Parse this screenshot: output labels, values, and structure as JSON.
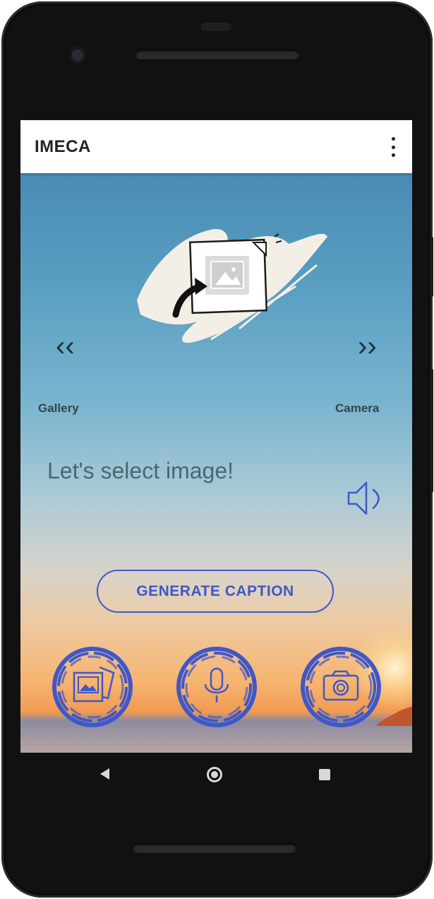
{
  "app": {
    "title": "IMECA"
  },
  "toolbar": {
    "menu_icon": "more-vert-icon"
  },
  "main": {
    "illustration_icon": "image-upload-illustration",
    "prev_arrow": "‹‹",
    "next_arrow": "››",
    "gallery_label": "Gallery",
    "camera_label": "Camera",
    "prompt_text": "Let's select image!",
    "speaker_icon": "speaker-icon",
    "generate_button_label": "GENERATE CAPTION"
  },
  "bottom_actions": [
    {
      "name": "gallery-button",
      "icon": "gallery-icon"
    },
    {
      "name": "microphone-button",
      "icon": "microphone-icon"
    },
    {
      "name": "camera-button",
      "icon": "camera-icon"
    }
  ],
  "system_nav": {
    "back": "back-icon",
    "home": "home-icon",
    "recent": "recent-apps-icon"
  },
  "colors": {
    "accent": "#3f57c9",
    "appbar": "#ffffff",
    "title_text": "#222222"
  }
}
